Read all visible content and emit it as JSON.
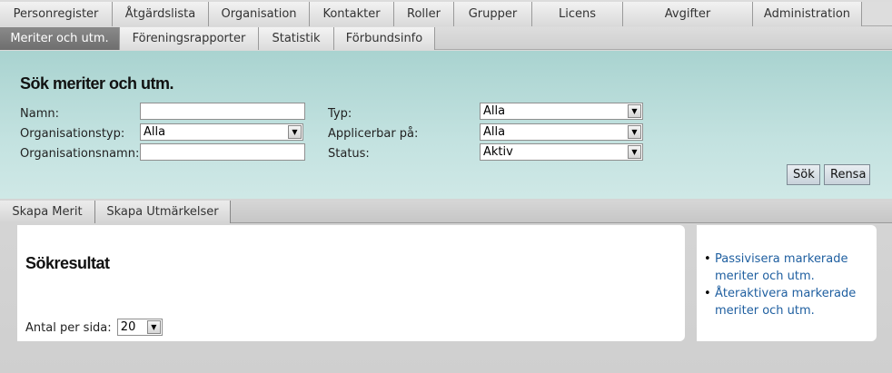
{
  "main_nav": [
    "Personregister",
    "Åtgärdslista",
    "Organisation",
    "Kontakter",
    "Roller",
    "Grupper",
    "Licens",
    "Avgifter",
    "Administration"
  ],
  "sub_nav": {
    "active": "Meriter och utm.",
    "items": [
      "Meriter och utm.",
      "Föreningsrapporter",
      "Statistik",
      "Förbundsinfo"
    ]
  },
  "search": {
    "title": "Sök meriter och utm.",
    "labels": {
      "namn": "Namn:",
      "orgtyp": "Organisationstyp:",
      "orgnamn": "Organisationsnamn:",
      "typ": "Typ:",
      "applicerbar": "Applicerbar på:",
      "status": "Status:"
    },
    "values": {
      "namn": "",
      "orgtyp": "Alla",
      "orgnamn": "",
      "typ": "Alla",
      "applicerbar": "Alla",
      "status": "Aktiv"
    },
    "buttons": {
      "search": "Sök",
      "clear": "Rensa"
    }
  },
  "action_tabs": [
    "Skapa Merit",
    "Skapa Utmärkelser"
  ],
  "results": {
    "title": "Sökresultat",
    "per_page_label": "Antal per sida:",
    "per_page_value": "20"
  },
  "side_links": [
    "Passivisera markerade meriter och utm.",
    "Återaktivera markerade meriter och utm."
  ],
  "icons": {
    "dropdown": "chevron-down-icon",
    "bullet": "bullet-icon"
  },
  "colors": {
    "search_panel": "#bfe0de",
    "active_tab": "#7a7a7a",
    "link": "#1f5fa0"
  }
}
